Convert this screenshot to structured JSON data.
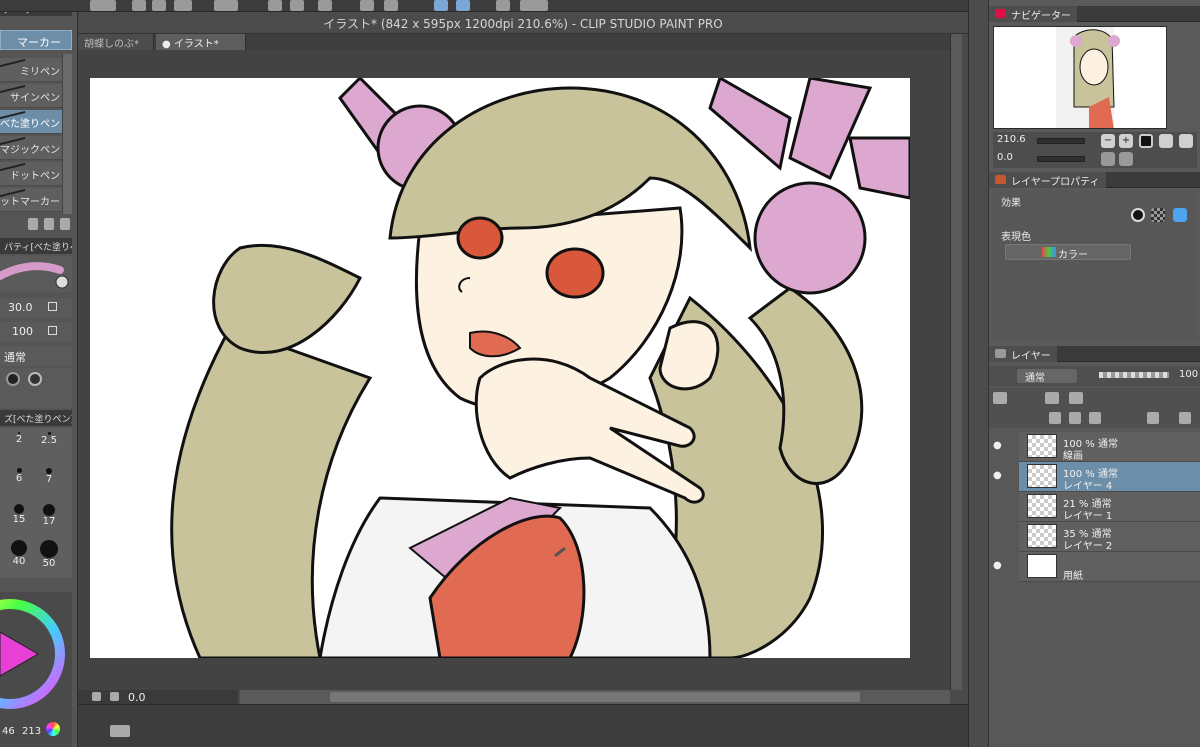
{
  "window": {
    "title": "イラスト* (842 x 595px 1200dpi 210.6%)  - CLIP STUDIO PAINT PRO"
  },
  "doc_tabs": [
    {
      "label": "胡蝶しのぶ*"
    },
    {
      "label": "● イラスト*"
    }
  ],
  "left_panel": {
    "header_label": "[ペン]",
    "selected_tab": "マーカー",
    "pens": [
      {
        "label": "ミリペン"
      },
      {
        "label": "サインペン"
      },
      {
        "label": "べた塗りペン"
      },
      {
        "label": "マジックペン"
      },
      {
        "label": "ドットペン"
      },
      {
        "label": "ットマーカー"
      }
    ],
    "property_header": "パティ[べた塗りペ",
    "brush_size": "30.0",
    "opacity": "100",
    "blend_mode": "通常",
    "size_header": "ズ[べた塗りペン]",
    "size_presets": [
      "2",
      "2.5",
      "6",
      "7",
      "15",
      "17",
      "40",
      "50"
    ],
    "color_readout": "46",
    "color_readout_b": "213"
  },
  "canvas": {
    "zoom": "0.0"
  },
  "navigator": {
    "tab_label": "ナビゲーター",
    "zoom_value": "210.6",
    "rotate_value": "0.0"
  },
  "layer_property": {
    "tab_label": "レイヤープロパティ",
    "effect_label": "効果",
    "expression_color_label": "表現色",
    "color_mode": "カラー"
  },
  "layer_panel": {
    "tab_label": "レイヤー",
    "blend_mode": "通常",
    "opacity": "100",
    "layers": [
      {
        "line1": "100 % 通常",
        "line2": "線画",
        "visible": true,
        "selected": false
      },
      {
        "line1": "100 % 通常",
        "line2": "レイヤー 4",
        "visible": true,
        "selected": true
      },
      {
        "line1": "21 % 通常",
        "line2": "レイヤー 1",
        "visible": false,
        "selected": false
      },
      {
        "line1": "35 % 通常",
        "line2": "レイヤー 2",
        "visible": false,
        "selected": false
      },
      {
        "line1": "",
        "line2": "用紙",
        "visible": true,
        "selected": false
      }
    ]
  },
  "colors": {
    "hair": "#c8c39a",
    "skin": "#fdf1e2",
    "eye": "#d9573b",
    "ribbon": "#e06a52",
    "pink": "#dca8d0",
    "selection": "#6d8ea8"
  }
}
